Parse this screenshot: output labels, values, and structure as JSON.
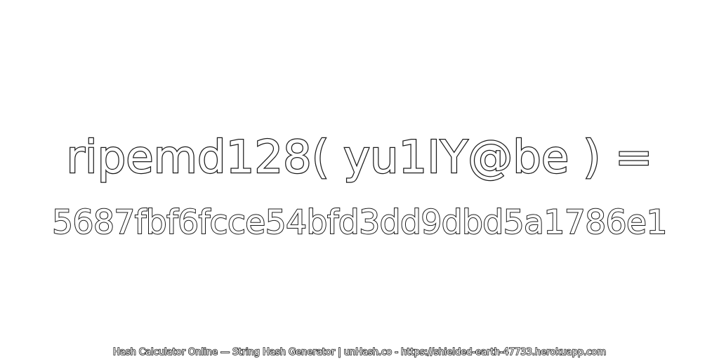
{
  "expression": "ripemd128( yu1IY@be ) =",
  "hash_value": "5687fbf6fcce54bfd3dd9dbd5a1786e1",
  "footer_text": "Hash Calculator Online — String Hash Generator | unHash.co - https://shielded-earth-47733.herokuapp.com",
  "colors": {
    "background": "#ffffff",
    "text_fill": "#ffffff",
    "text_outline": "#1a1a1a"
  }
}
